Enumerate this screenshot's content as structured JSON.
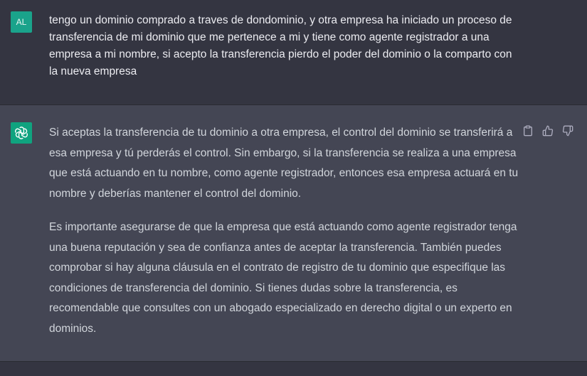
{
  "user_message": {
    "avatar_initials": "AL",
    "text": "tengo un dominio comprado a traves de dondominio, y otra empresa ha iniciado un proceso de transferencia de mi dominio que me pertenece a mi y tiene como agente registrador a una empresa a mi nombre, si acepto la transferencia pierdo el poder del dominio o la comparto con la nueva empresa"
  },
  "assistant_message": {
    "avatar_icon": "openai-logo-icon",
    "paragraphs": [
      "Si aceptas la transferencia de tu dominio a otra empresa, el control del dominio se transferirá a esa empresa y tú perderás el control. Sin embargo, si la transferencia se realiza a una empresa que está actuando en tu nombre, como agente registrador, entonces esa empresa actuará en tu nombre y deberías mantener el control del dominio.",
      "Es importante asegurarse de que la empresa que está actuando como agente registrador tenga una buena reputación y sea de confianza antes de aceptar la transferencia. También puedes comprobar si hay alguna cláusula en el contrato de registro de tu dominio que especifique las condiciones de transferencia del dominio. Si tienes dudas sobre la transferencia, es recomendable que consultes con un abogado especializado en derecho digital o un experto en dominios."
    ],
    "actions": [
      "clipboard-icon",
      "thumbs-up-icon",
      "thumbs-down-icon"
    ]
  },
  "colors": {
    "user_bg": "#343541",
    "assistant_bg": "#444654",
    "avatar_user": "#1aa38b",
    "avatar_bot": "#10a37f",
    "text": "#ececf1"
  }
}
